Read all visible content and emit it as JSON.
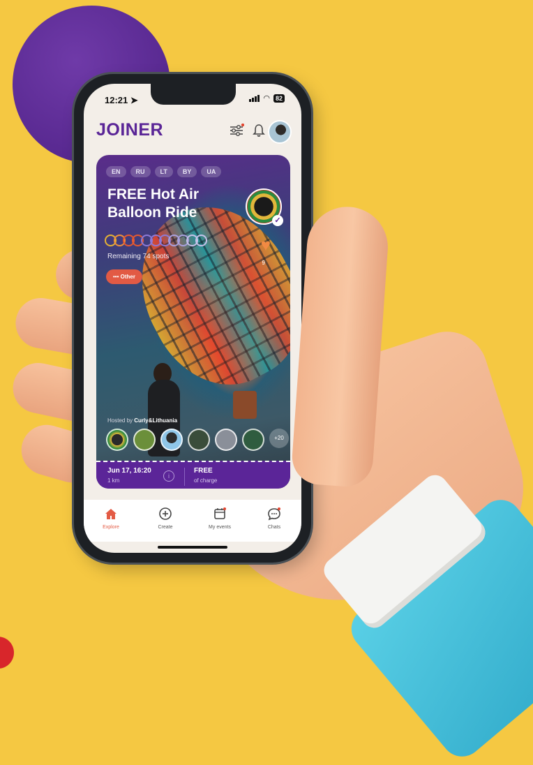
{
  "status_bar": {
    "time": "12:21",
    "battery": "82"
  },
  "app": {
    "logo": "JOINER"
  },
  "header_icons": [
    "filter-sliders-icon",
    "bell-icon",
    "user-avatar"
  ],
  "event": {
    "languages": [
      "EN",
      "RU",
      "LT",
      "BY",
      "UA"
    ],
    "title": "FREE Hot Air Balloon Ride",
    "remaining": "Remaining 74 spots",
    "category": "••• Other",
    "hosted_by_prefix": "Hosted by",
    "host_name": "Curly&Lithuania",
    "attendees_more": "+20",
    "like_count": "9",
    "date": "Jun 17, 16:20",
    "distance": "1 km",
    "price": "FREE",
    "price_sub": "of charge"
  },
  "tabs": [
    {
      "label": "Explore",
      "icon": "home-icon",
      "active": true
    },
    {
      "label": "Create",
      "icon": "plus-circle-icon",
      "active": false
    },
    {
      "label": "My events",
      "icon": "calendar-icon",
      "active": false
    },
    {
      "label": "Chats",
      "icon": "chat-bubble-icon",
      "active": false
    }
  ],
  "colors": {
    "background": "#f5c842",
    "brand_purple": "#5a2597",
    "accent_red": "#e35b45",
    "sleeve": "#3bb8d6"
  }
}
